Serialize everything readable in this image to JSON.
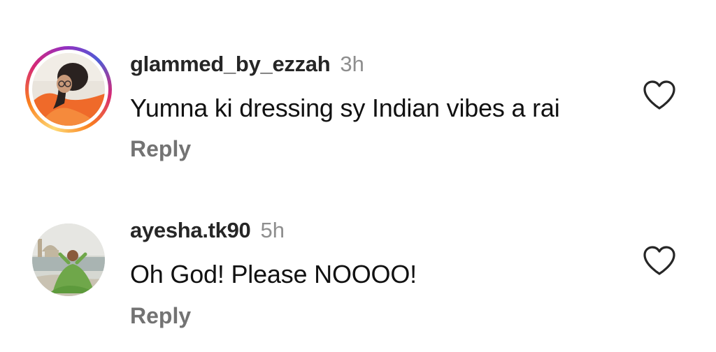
{
  "comments": [
    {
      "username": "glammed_by_ezzah",
      "time": "3h",
      "text": "Yumna ki dressing sy Indian vibes a rai",
      "reply_label": "Reply",
      "has_story_ring": true,
      "like_icon": "heart-outline-icon"
    },
    {
      "username": "ayesha.tk90",
      "time": "5h",
      "text": "Oh God! Please NOOOO!",
      "reply_label": "Reply",
      "has_story_ring": false,
      "like_icon": "heart-outline-icon"
    }
  ],
  "colors": {
    "username": "#262626",
    "timestamp": "#8e8e8e",
    "reply": "#737373",
    "text": "#111111",
    "story_ring": [
      "#feda75",
      "#fa7e1e",
      "#d62976",
      "#962fbf",
      "#4f5bd5"
    ]
  }
}
